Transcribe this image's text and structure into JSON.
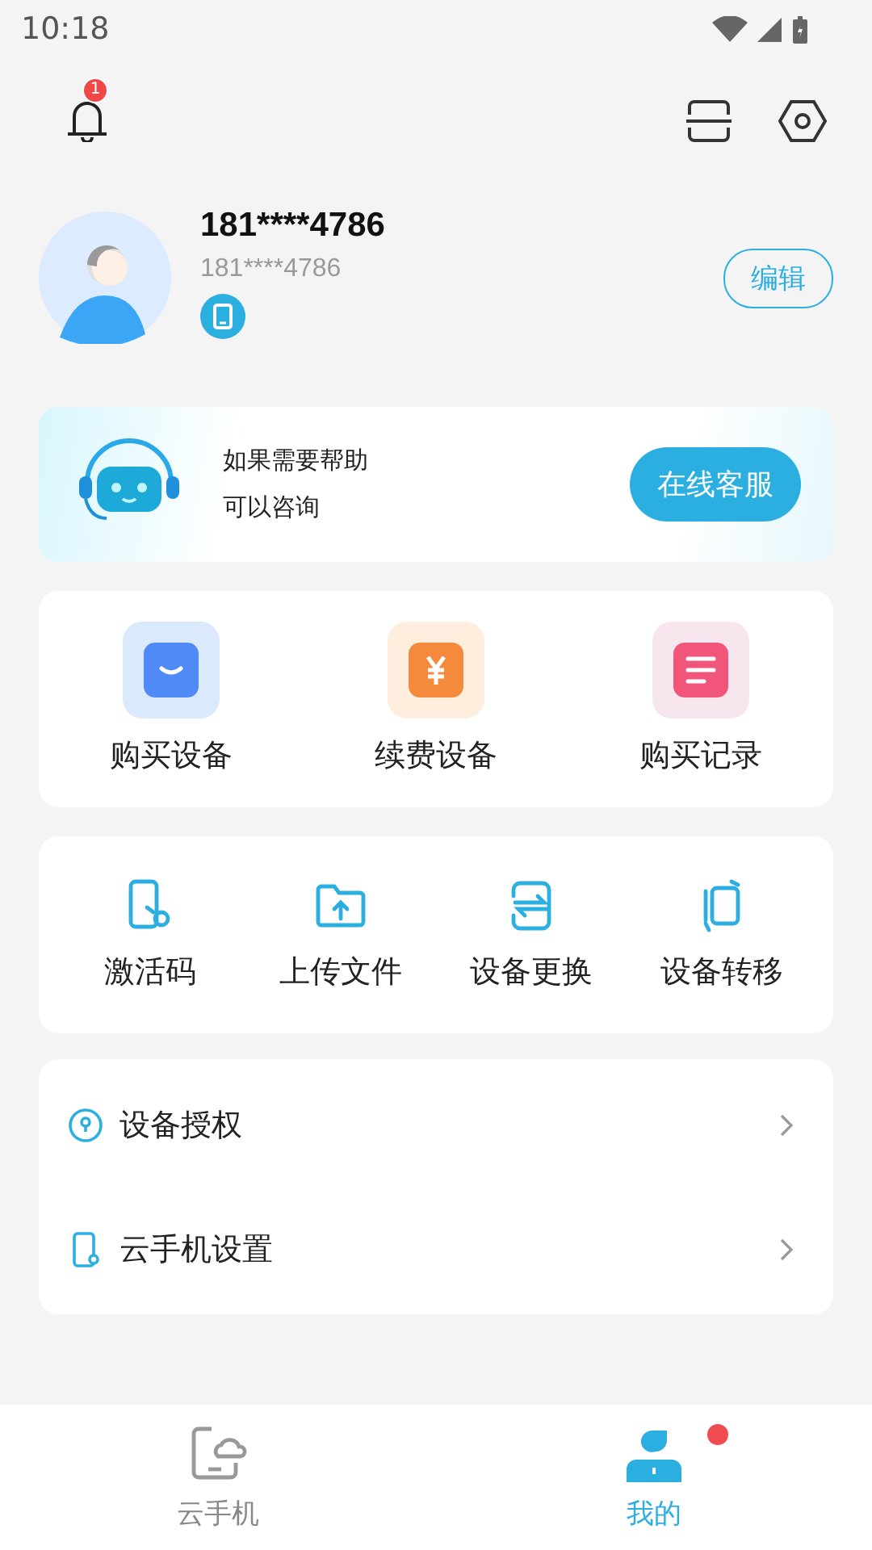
{
  "status_bar": {
    "time": "10:18"
  },
  "header": {
    "notification_badge": "1"
  },
  "profile": {
    "name": "181****4786",
    "phone": "181****4786",
    "edit_button": "编辑"
  },
  "help_card": {
    "lines": [
      "如果需要帮助",
      "可以咨询"
    ],
    "button": "在线客服"
  },
  "purchase_actions": [
    {
      "kind": "bag",
      "label": "购买设备"
    },
    {
      "kind": "yuan",
      "label": "续费设备"
    },
    {
      "kind": "list",
      "label": "购买记录"
    }
  ],
  "tools": [
    {
      "kind": "key",
      "label": "激活码"
    },
    {
      "kind": "upload",
      "label": "上传文件"
    },
    {
      "kind": "swap",
      "label": "设备更换"
    },
    {
      "kind": "transfer",
      "label": "设备转移"
    }
  ],
  "menu": [
    {
      "kind": "lock",
      "label": "设备授权"
    },
    {
      "kind": "phone",
      "label": "云手机设置"
    }
  ],
  "bottom_nav": [
    {
      "kind": "cloud",
      "label": "云手机",
      "selected": false,
      "dot": false
    },
    {
      "kind": "user",
      "label": "我的",
      "selected": true,
      "dot": true
    }
  ]
}
